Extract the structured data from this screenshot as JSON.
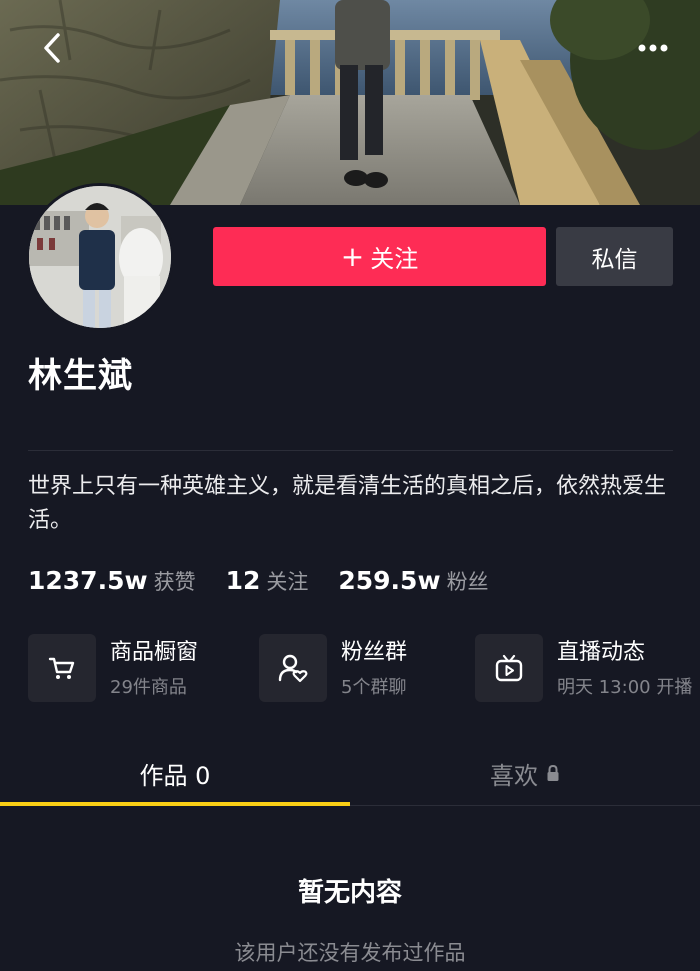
{
  "cover": {
    "image": "lakeside-walkway-photo"
  },
  "nav": {
    "back_icon": "chevron-left-icon",
    "more_icon": "more-dots-icon"
  },
  "profile": {
    "avatar": "user-avatar-photo",
    "name": "林生斌",
    "bio": "世界上只有一种英雄主义，就是看清生活的真相之后，依然热爱生活。"
  },
  "actions": {
    "follow_plus": "+",
    "follow_label": "关注",
    "message_label": "私信",
    "follow_color": "#fe2c55"
  },
  "stats": [
    {
      "value": "1237.5w",
      "label": "获赞"
    },
    {
      "value": "12",
      "label": "关注"
    },
    {
      "value": "259.5w",
      "label": "粉丝"
    }
  ],
  "features": [
    {
      "icon": "shopping-cart-icon",
      "title": "商品橱窗",
      "subtitle": "29件商品"
    },
    {
      "icon": "fan-group-icon",
      "title": "粉丝群",
      "subtitle": "5个群聊"
    },
    {
      "icon": "live-tv-icon",
      "title": "直播动态",
      "subtitle": "明天 13:00 开播"
    }
  ],
  "tabs": {
    "works": "作品 0",
    "likes": "喜欢",
    "likes_icon": "lock-icon",
    "indicator_color": "#face15"
  },
  "empty": {
    "title": "暂无内容",
    "subtitle": "该用户还没有发布过作品"
  }
}
